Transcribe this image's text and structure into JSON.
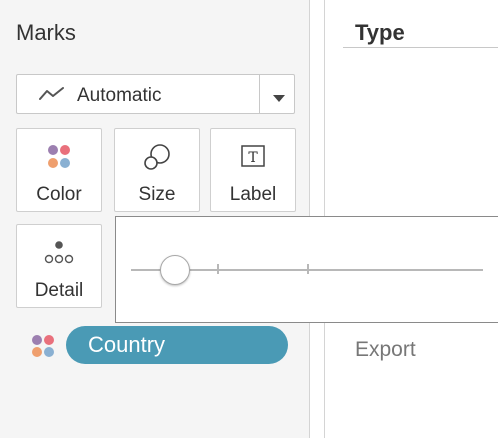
{
  "marks": {
    "title": "Marks",
    "mark_type": {
      "icon": "line-chart-icon",
      "label": "Automatic",
      "dropdown_icon": "caret-down-icon"
    },
    "cards": [
      {
        "label": "Color",
        "icon": "color-dots-icon"
      },
      {
        "label": "Size",
        "icon": "size-circles-icon"
      },
      {
        "label": "Label",
        "icon": "text-label-icon"
      },
      {
        "label": "Detail",
        "icon": "detail-dots-icon"
      }
    ],
    "field_pill": {
      "label": "Country",
      "icon": "color-dots-icon",
      "color": "#4a9ab5"
    }
  },
  "right_panel": {
    "header": "Type",
    "export_label": "Export"
  },
  "size_popup": {
    "slider_value": 0.12,
    "slider_icon": "slider-thumb"
  },
  "colors": {
    "dot_purple": "#9c7fb0",
    "dot_red": "#e9707c",
    "dot_orange": "#ef9f6e",
    "dot_blue": "#8ab0d2",
    "pill": "#4a9ab5"
  }
}
